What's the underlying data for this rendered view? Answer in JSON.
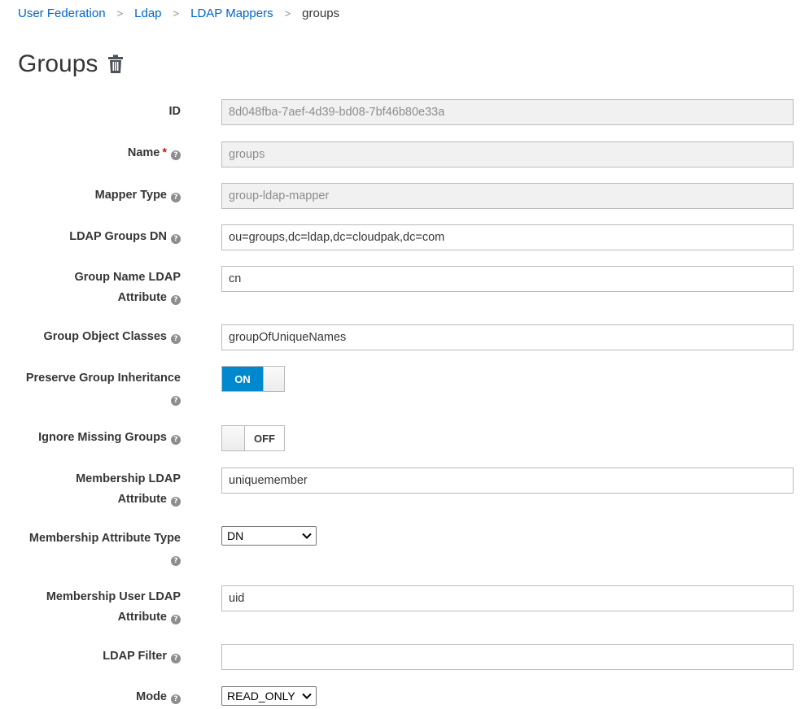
{
  "breadcrumb": {
    "items": [
      "User Federation",
      "Ldap",
      "LDAP Mappers"
    ],
    "current": "groups",
    "separator": ">"
  },
  "page": {
    "title": "Groups"
  },
  "form": {
    "id": {
      "label": "ID",
      "value": "8d048fba-7aef-4d39-bd08-7bf46b80e33a"
    },
    "name": {
      "label": "Name",
      "required_mark": "*",
      "value": "groups"
    },
    "mapper_type": {
      "label": "Mapper Type",
      "value": "group-ldap-mapper"
    },
    "ldap_groups_dn": {
      "label": "LDAP Groups DN",
      "value": "ou=groups,dc=ldap,dc=cloudpak,dc=com"
    },
    "group_name_attr": {
      "label_line1": "Group Name LDAP",
      "label_line2": "Attribute",
      "value": "cn"
    },
    "group_object_classes": {
      "label": "Group Object Classes",
      "value": "groupOfUniqueNames"
    },
    "preserve_inheritance": {
      "label": "Preserve Group Inheritance",
      "state": "ON"
    },
    "ignore_missing": {
      "label": "Ignore Missing Groups",
      "state": "OFF"
    },
    "membership_attr": {
      "label_line1": "Membership LDAP",
      "label_line2": "Attribute",
      "value": "uniquemember"
    },
    "membership_attr_type": {
      "label": "Membership Attribute Type",
      "selected": "DN"
    },
    "membership_user_attr": {
      "label_line1": "Membership User LDAP",
      "label_line2": "Attribute",
      "value": "uid"
    },
    "ldap_filter": {
      "label": "LDAP Filter",
      "value": ""
    },
    "mode": {
      "label": "Mode",
      "selected": "READ_ONLY"
    }
  },
  "colors": {
    "link": "#0066cc",
    "toggle_on": "#0088ce",
    "required": "#c9190b"
  },
  "icons": {
    "delete": "trash-icon",
    "help": "question-circle-icon",
    "dropdown": "chevron-down-icon"
  }
}
